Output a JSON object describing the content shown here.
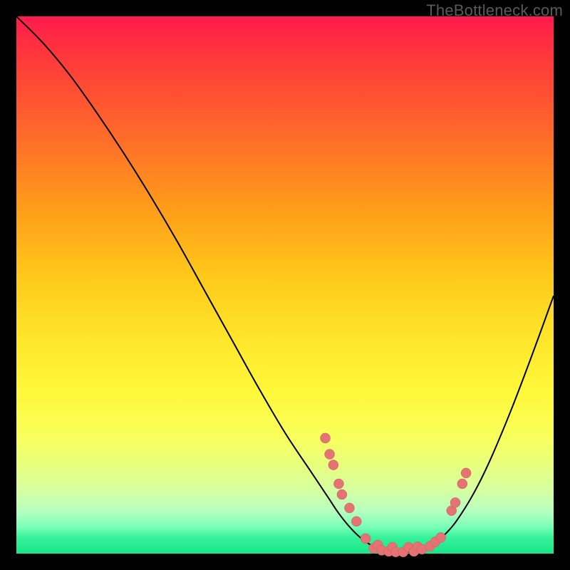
{
  "watermark": "TheBottleneck.com",
  "colors": {
    "dot_fill": "#e57373",
    "dot_stroke": "#c85a5a",
    "curve_stroke": "#000000"
  },
  "chart_data": {
    "type": "line",
    "title": "",
    "xlabel": "",
    "ylabel": "",
    "xlim": [
      0,
      100
    ],
    "ylim": [
      0,
      100
    ],
    "curve": [
      {
        "x": 0.0,
        "y": 100.0
      },
      {
        "x": 5.0,
        "y": 95.0
      },
      {
        "x": 10.0,
        "y": 89.0
      },
      {
        "x": 15.0,
        "y": 82.0
      },
      {
        "x": 20.0,
        "y": 74.5
      },
      {
        "x": 25.0,
        "y": 66.5
      },
      {
        "x": 30.0,
        "y": 58.0
      },
      {
        "x": 35.0,
        "y": 49.0
      },
      {
        "x": 40.0,
        "y": 40.0
      },
      {
        "x": 45.0,
        "y": 31.0
      },
      {
        "x": 50.0,
        "y": 22.5
      },
      {
        "x": 55.0,
        "y": 15.0
      },
      {
        "x": 58.0,
        "y": 10.5
      },
      {
        "x": 60.0,
        "y": 7.5
      },
      {
        "x": 62.0,
        "y": 5.0
      },
      {
        "x": 64.0,
        "y": 3.0
      },
      {
        "x": 66.0,
        "y": 1.6
      },
      {
        "x": 68.0,
        "y": 0.8
      },
      {
        "x": 70.0,
        "y": 0.4
      },
      {
        "x": 72.0,
        "y": 0.3
      },
      {
        "x": 74.0,
        "y": 0.4
      },
      {
        "x": 76.0,
        "y": 0.9
      },
      {
        "x": 78.0,
        "y": 2.0
      },
      {
        "x": 80.0,
        "y": 3.8
      },
      {
        "x": 82.0,
        "y": 6.2
      },
      {
        "x": 85.0,
        "y": 11.0
      },
      {
        "x": 88.0,
        "y": 17.0
      },
      {
        "x": 92.0,
        "y": 26.5
      },
      {
        "x": 96.0,
        "y": 37.0
      },
      {
        "x": 100.0,
        "y": 48.0
      }
    ],
    "points": [
      {
        "x": 57.5,
        "y": 21.5
      },
      {
        "x": 58.3,
        "y": 18.5
      },
      {
        "x": 59.0,
        "y": 16.5
      },
      {
        "x": 60.0,
        "y": 13.0
      },
      {
        "x": 60.6,
        "y": 11.0
      },
      {
        "x": 62.0,
        "y": 8.5
      },
      {
        "x": 63.3,
        "y": 6.0
      },
      {
        "x": 65.0,
        "y": 2.8
      },
      {
        "x": 66.5,
        "y": 1.0
      },
      {
        "x": 67.3,
        "y": 1.6
      },
      {
        "x": 68.0,
        "y": 0.6
      },
      {
        "x": 69.3,
        "y": 0.4
      },
      {
        "x": 70.0,
        "y": 1.2
      },
      {
        "x": 70.6,
        "y": 0.3
      },
      {
        "x": 72.0,
        "y": 0.3
      },
      {
        "x": 73.0,
        "y": 1.2
      },
      {
        "x": 74.0,
        "y": 0.4
      },
      {
        "x": 74.7,
        "y": 1.3
      },
      {
        "x": 75.5,
        "y": 0.8
      },
      {
        "x": 77.0,
        "y": 1.4
      },
      {
        "x": 78.0,
        "y": 2.2
      },
      {
        "x": 79.0,
        "y": 3.0
      },
      {
        "x": 81.0,
        "y": 8.0
      },
      {
        "x": 81.7,
        "y": 9.5
      },
      {
        "x": 83.0,
        "y": 13.0
      },
      {
        "x": 83.7,
        "y": 15.0
      }
    ]
  }
}
